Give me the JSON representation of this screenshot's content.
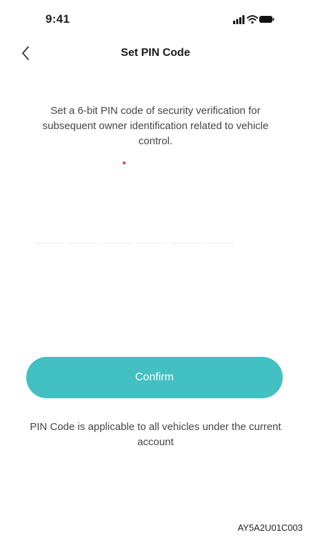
{
  "status_bar": {
    "time": "9:41",
    "icons": [
      "signal-icon",
      "wifi-icon",
      "battery-icon"
    ]
  },
  "nav": {
    "back_icon": "chevron-left-icon",
    "title": "Set PIN Code"
  },
  "description": "Set a 6-bit PIN code of security verification for subsequent owner identification related to vehicle control.",
  "pin": {
    "length": 6,
    "value": ""
  },
  "confirm_button": {
    "label": "Confirm",
    "color": "#42c0c2"
  },
  "note": "PIN Code is applicable to all vehicles under the current account",
  "figure_code": "AY5A2U01C003"
}
